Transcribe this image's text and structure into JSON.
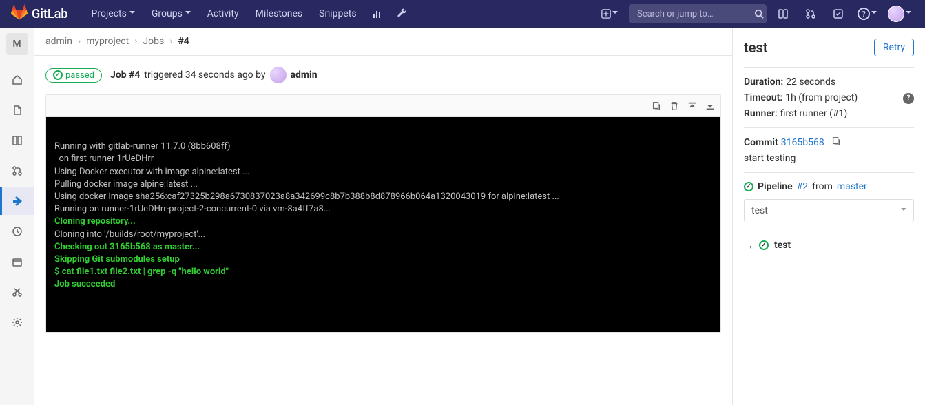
{
  "topnav": {
    "brand": "GitLab",
    "links": {
      "projects": "Projects",
      "groups": "Groups",
      "activity": "Activity",
      "milestones": "Milestones",
      "snippets": "Snippets"
    },
    "search_placeholder": "Search or jump to…"
  },
  "sidebar": {
    "avatar_letter": "M"
  },
  "breadcrumb": {
    "admin": "admin",
    "project": "myproject",
    "jobs": "Jobs",
    "current": "#4"
  },
  "status": {
    "badge": "passed",
    "job_label": "Job #4",
    "triggered_text": "triggered 34 seconds ago by",
    "user": "admin"
  },
  "log": {
    "l1": "Running with gitlab-runner 11.7.0 (8bb608ff)",
    "l2": "  on first runner 1rUeDHrr",
    "l3": "Using Docker executor with image alpine:latest ...",
    "l4": "Pulling docker image alpine:latest ...",
    "l5": "Using docker image sha256:caf27325b298a6730837023a8a342699c8b7b388b8d878966b064a1320043019 for alpine:latest ...",
    "l6": "Running on runner-1rUeDHrr-project-2-concurrent-0 via vm-8a4ff7a8...",
    "l7": "Cloning repository...",
    "l8": "Cloning into '/builds/root/myproject'...",
    "l9": "Checking out 3165b568 as master...",
    "l10": "Skipping Git submodules setup",
    "l11": "$ cat file1.txt file2.txt | grep -q \"hello world\"",
    "l12": "Job succeeded"
  },
  "right": {
    "title": "test",
    "retry": "Retry",
    "duration_label": "Duration:",
    "duration_value": "22 seconds",
    "timeout_label": "Timeout:",
    "timeout_value": "1h (from project)",
    "runner_label": "Runner:",
    "runner_value": "first runner (#1)",
    "commit_label": "Commit",
    "commit_sha": "3165b568",
    "commit_msg": "start testing",
    "pipeline_label": "Pipeline",
    "pipeline_id": "#2",
    "pipeline_from": "from",
    "pipeline_branch": "master",
    "select_value": "test",
    "stage_name": "test"
  }
}
